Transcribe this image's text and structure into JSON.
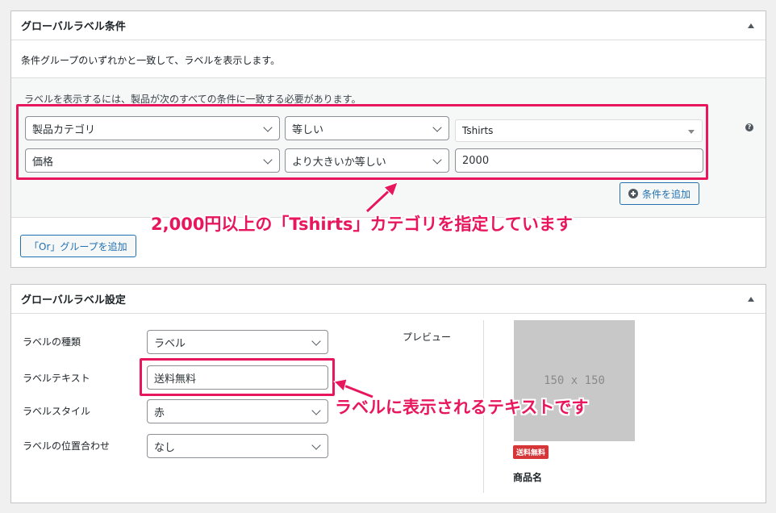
{
  "conditions_panel": {
    "title": "グローバルラベル条件",
    "description": "条件グループのいずれかと一致して、ラベルを表示します。",
    "group_hint": "ラベルを表示するには、製品が次のすべての条件に一致する必要があります。",
    "rows": [
      {
        "field": "製品カテゴリ",
        "operator": "等しい",
        "value": "Tshirts"
      },
      {
        "field": "価格",
        "operator": "より大きいか等しい",
        "value": "2000"
      }
    ],
    "add_condition_label": "条件を追加",
    "add_or_group_label": "「Or」グループを追加",
    "help_glyph": "?"
  },
  "settings_panel": {
    "title": "グローバルラベル設定",
    "fields": {
      "type": {
        "label": "ラベルの種類",
        "value": "ラベル"
      },
      "text": {
        "label": "ラベルテキスト",
        "value": "送料無料"
      },
      "style": {
        "label": "ラベルスタイル",
        "value": "赤"
      },
      "position": {
        "label": "ラベルの位置合わせ",
        "value": "なし"
      }
    },
    "preview": {
      "label": "プレビュー",
      "placeholder": "150 x 150",
      "badge": "送料無料",
      "product_name": "商品名"
    }
  },
  "annotations": {
    "condition_callout": "2,000円以上の「Tshirts」カテゴリを指定しています",
    "text_callout": "ラベルに表示されるテキストです",
    "accent_color": "#e8175d"
  }
}
